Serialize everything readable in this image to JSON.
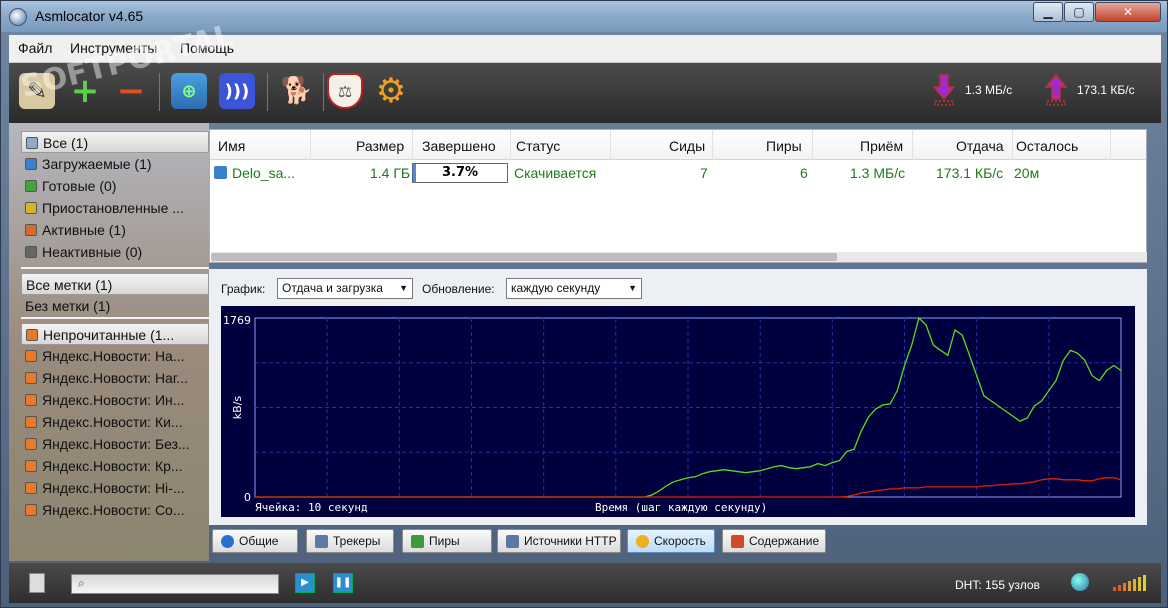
{
  "window": {
    "title": "Asmlocator v4.65"
  },
  "menu": [
    "Файл",
    "Инструменты",
    "Помощь"
  ],
  "toolbar": {
    "icons": [
      "create-icon",
      "add-icon",
      "remove-icon",
      "network-icon",
      "rss-icon",
      "dog-icon",
      "shield-icon",
      "gear-icon"
    ],
    "download_speed": "1.3 МБ/с",
    "upload_speed": "173.1 КБ/с"
  },
  "sidebar": {
    "status": [
      {
        "label": "Все (1)",
        "icon": "all-icon",
        "color": "#8fa9c9"
      },
      {
        "label": "Загружаемые (1)",
        "icon": "download-icon",
        "color": "#3b7fd1"
      },
      {
        "label": "Готовые (0)",
        "icon": "done-icon",
        "color": "#46a23c"
      },
      {
        "label": "Приостановленные ...",
        "icon": "pause-icon",
        "color": "#d6b42a"
      },
      {
        "label": "Активные (1)",
        "icon": "active-icon",
        "color": "#d66a2a"
      },
      {
        "label": "Неактивные (0)",
        "icon": "inactive-icon",
        "color": "#666666"
      }
    ],
    "labels": [
      {
        "label": "Все метки (1)"
      },
      {
        "label": "Без метки (1)"
      }
    ],
    "feeds": [
      {
        "label": "Непрочитанные  (1..."
      },
      {
        "label": "Яндекс.Новости: На..."
      },
      {
        "label": "Яндекс.Новости: Наг..."
      },
      {
        "label": "Яндекс.Новости: Ин..."
      },
      {
        "label": "Яндекс.Новости: Ки..."
      },
      {
        "label": "Яндекс.Новости: Без..."
      },
      {
        "label": "Яндекс.Новости: Кр..."
      },
      {
        "label": "Яндекс.Новости: Hi-..."
      },
      {
        "label": "Яндекс.Новости: Со..."
      }
    ]
  },
  "table": {
    "columns": [
      "Имя",
      "Размер",
      "Завершено",
      "Статус",
      "Сиды",
      "Пиры",
      "Приём",
      "Отдача",
      "Осталось"
    ],
    "rows": [
      {
        "name": "Delo_sa...",
        "size": "1.4 ГБ",
        "done": "3.7%",
        "done_fraction": 0.037,
        "status": "Скачивается",
        "seeds": "7",
        "peers": "6",
        "down": "1.3 МБ/с",
        "up": "173.1 КБ/с",
        "eta": "20м"
      }
    ]
  },
  "graph_panel": {
    "graph_label": "График:",
    "graph_value": "Отдача и загрузка",
    "update_label": "Обновление:",
    "update_value": "каждую секунду"
  },
  "chart_data": {
    "type": "line",
    "title": "",
    "ylabel": "kB/s",
    "xlabel": "Время (шаг каждую секунду)",
    "cell_label": "Ячейка: 10 секунд",
    "ylim": [
      0,
      1769
    ],
    "ytick_labels": [
      "0",
      "1769"
    ],
    "x": [
      0,
      1,
      2,
      3,
      4,
      5,
      6,
      7,
      8,
      9,
      10,
      11,
      12,
      13,
      14,
      15,
      16,
      17,
      18,
      19,
      20,
      21,
      22,
      23,
      24,
      25,
      26,
      27,
      28,
      29,
      30,
      31,
      32,
      33,
      34,
      35,
      36,
      37,
      38,
      39,
      40,
      41,
      42,
      43,
      44,
      45,
      46,
      47,
      48,
      49,
      50,
      51,
      52,
      53,
      54,
      55,
      56,
      57,
      58,
      59,
      60,
      61,
      62,
      63,
      64,
      65,
      66,
      67,
      68,
      69,
      70,
      71,
      72,
      73,
      74,
      75,
      76,
      77,
      78,
      79,
      80,
      81,
      82,
      83,
      84,
      85,
      86,
      87,
      88,
      89,
      90,
      91,
      92,
      93,
      94,
      95,
      96,
      97,
      98,
      99,
      100,
      101,
      102,
      103,
      104,
      105,
      106,
      107,
      108,
      109,
      110,
      111,
      112,
      113,
      114,
      115,
      116,
      117,
      118,
      119,
      120
    ],
    "series": [
      {
        "color": "#55dd22",
        "values": [
          0,
          0,
          0,
          0,
          0,
          0,
          0,
          0,
          0,
          0,
          0,
          0,
          0,
          0,
          0,
          0,
          0,
          0,
          0,
          0,
          0,
          0,
          0,
          0,
          0,
          0,
          0,
          0,
          0,
          0,
          0,
          0,
          0,
          0,
          0,
          0,
          0,
          0,
          0,
          0,
          0,
          0,
          0,
          0,
          0,
          0,
          0,
          0,
          0,
          0,
          0,
          0,
          0,
          0,
          0,
          20,
          60,
          110,
          150,
          170,
          190,
          200,
          230,
          250,
          260,
          270,
          260,
          250,
          240,
          250,
          260,
          280,
          300,
          310,
          290,
          280,
          290,
          300,
          330,
          310,
          340,
          360,
          450,
          470,
          650,
          790,
          870,
          910,
          920,
          1050,
          1300,
          1500,
          1769,
          1700,
          1500,
          1450,
          1400,
          1650,
          1600,
          1400,
          1200,
          1000,
          950,
          900,
          850,
          800,
          750,
          780,
          900,
          950,
          1050,
          1150,
          1350,
          1450,
          1420,
          1350,
          1200,
          1150,
          1250,
          1300,
          1250
        ]
      },
      {
        "color": "#dd2200",
        "values": [
          0,
          0,
          0,
          0,
          0,
          0,
          0,
          0,
          0,
          0,
          0,
          0,
          0,
          0,
          0,
          0,
          0,
          0,
          0,
          0,
          0,
          0,
          0,
          0,
          0,
          0,
          0,
          0,
          0,
          0,
          0,
          0,
          0,
          0,
          0,
          0,
          0,
          0,
          0,
          0,
          0,
          0,
          0,
          0,
          0,
          0,
          0,
          0,
          0,
          0,
          0,
          0,
          0,
          0,
          0,
          0,
          0,
          0,
          0,
          0,
          0,
          0,
          0,
          0,
          0,
          0,
          0,
          0,
          0,
          0,
          0,
          0,
          0,
          0,
          0,
          0,
          0,
          0,
          0,
          0,
          0,
          0,
          5,
          20,
          40,
          50,
          60,
          70,
          80,
          80,
          90,
          90,
          90,
          100,
          100,
          100,
          100,
          100,
          100,
          100,
          100,
          110,
          110,
          120,
          120,
          130,
          130,
          140,
          150,
          170,
          180,
          180,
          170,
          170,
          170,
          160,
          160,
          180,
          190,
          190,
          170
        ]
      }
    ]
  },
  "tabs": [
    {
      "label": "Общие",
      "color": "#2a6fd0"
    },
    {
      "label": "Трекеры",
      "color": "#5a7aa5"
    },
    {
      "label": "Пиры",
      "color": "#3b9b3b"
    },
    {
      "label": "Источники HTTP",
      "color": "#5a7aa5"
    },
    {
      "label": "Скорость",
      "color": "#f0b020",
      "active": true
    },
    {
      "label": "Содержание",
      "color": "#d04a2a"
    }
  ],
  "statusbar": {
    "dht": "DHT: 155 узлов"
  }
}
